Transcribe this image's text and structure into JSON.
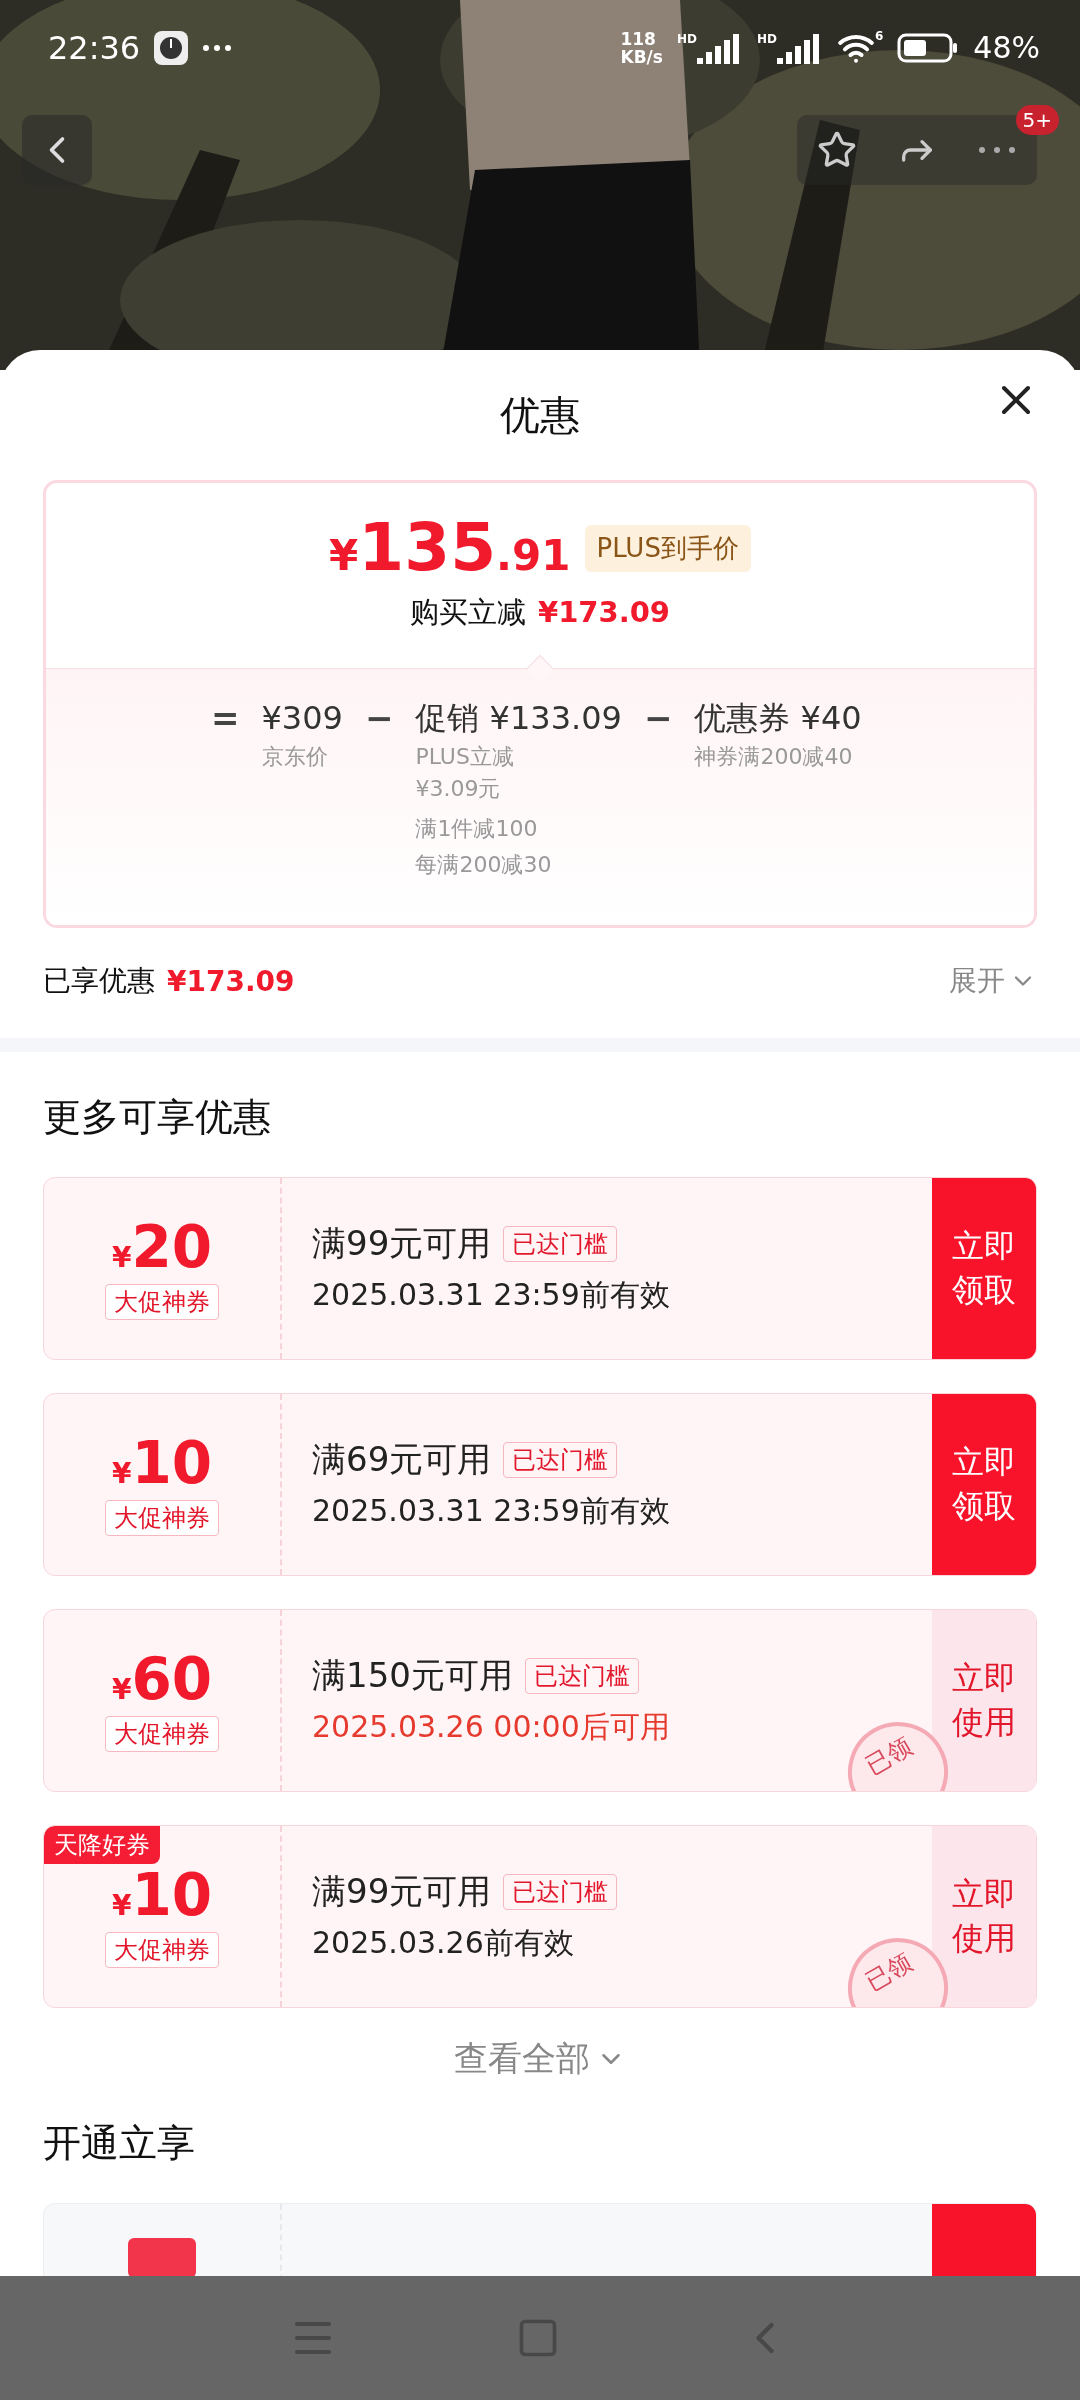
{
  "status_bar": {
    "time": "22:36",
    "speed": [
      "118",
      "KB/s"
    ],
    "signals": [
      {
        "label": "HD"
      },
      {
        "label": "HD"
      }
    ],
    "wifi_label": "6",
    "battery": "48%"
  },
  "top_bar": {
    "badge": "5+"
  },
  "sheet": {
    "title": "优惠"
  },
  "price_card": {
    "currency": "¥",
    "integer": "135",
    "decimal": ".91",
    "tag": "PLUS到手价",
    "saving_label": "购买立减",
    "saving": "¥173.09",
    "breakdown": [
      {
        "kind": "operator",
        "symbol": "="
      },
      {
        "kind": "item",
        "amount": "¥309",
        "notes": [
          "京东价"
        ]
      },
      {
        "kind": "operator",
        "symbol": "−"
      },
      {
        "kind": "item",
        "label": "促销",
        "amount": "¥133.09",
        "notes": [
          "PLUS立减",
          "¥3.09元",
          "满1件减100",
          "每满200减30"
        ]
      },
      {
        "kind": "operator",
        "symbol": "−"
      },
      {
        "kind": "item",
        "label": "优惠券",
        "amount": "¥40",
        "notes": [
          "神券满200减40"
        ]
      }
    ]
  },
  "enjoyed": {
    "label": "已享优惠",
    "value": "¥173.09",
    "toggle": "展开"
  },
  "more_section": {
    "title": "更多可享优惠",
    "coupons": [
      {
        "currency": "¥",
        "amount": "20",
        "type_label": "大促神券",
        "condition": "满99元可用",
        "threshold": "已达门槛",
        "validity": "2025.03.31 23:59前有效",
        "validity_highlight": false,
        "action": "立即领取",
        "claimed": false
      },
      {
        "currency": "¥",
        "amount": "10",
        "type_label": "大促神券",
        "condition": "满69元可用",
        "threshold": "已达门槛",
        "validity": "2025.03.31 23:59前有效",
        "validity_highlight": false,
        "action": "立即领取",
        "claimed": false
      },
      {
        "currency": "¥",
        "amount": "60",
        "type_label": "大促神券",
        "condition": "满150元可用",
        "threshold": "已达门槛",
        "validity": "2025.03.26 00:00后可用",
        "validity_highlight": true,
        "action": "立即使用",
        "claimed": true,
        "stamp": "已领"
      },
      {
        "currency": "¥",
        "amount": "10",
        "type_label": "大促神券",
        "condition": "满99元可用",
        "threshold": "已达门槛",
        "validity": "2025.03.26前有效",
        "validity_highlight": false,
        "action": "立即使用",
        "claimed": true,
        "stamp": "已领",
        "ribbon": "天降好券"
      }
    ],
    "view_all": "查看全部"
  },
  "open_section": {
    "title": "开通立享"
  }
}
